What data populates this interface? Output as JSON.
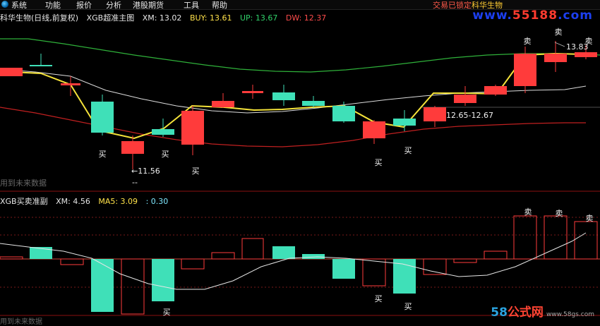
{
  "menu": {
    "items": [
      "系统",
      "功能",
      "报价",
      "分析",
      "港股期货",
      "工具",
      "帮助"
    ],
    "status": "交易已锁定",
    "stock_name": "科华生物"
  },
  "watermark": {
    "site": "www.",
    "digits": "55188",
    "tld": ".com"
  },
  "main_header": {
    "stock": "科华生物(日线,前复权)",
    "indicator": "XGB超准主图",
    "xm": "XM: 13.02",
    "buy": "BUY: 13.61",
    "up": "UP: 13.67",
    "dw": "DW: 12.37"
  },
  "sub_header": {
    "indicator": "XGB买卖准副",
    "xm": "XM: 4.56",
    "ma5": "MA5: 3.09",
    "extra": ": 0.30"
  },
  "faded_label": "用到未来数据",
  "bottom_watermark": {
    "num": "58",
    "text": "公式网",
    "url": "www.58gs.com"
  },
  "annotations": {
    "low_price": "←11.56",
    "high_price": "13.83",
    "range": "12.65-12.67",
    "buy": "买",
    "sell": "卖"
  },
  "colors": {
    "up": "#ff3b3b",
    "down": "#3fe0b8",
    "upper_band": "#2fb13a",
    "mid_band": "#dcdcdc",
    "lower_band": "#c02020",
    "trend": "#f5e33a"
  }
}
